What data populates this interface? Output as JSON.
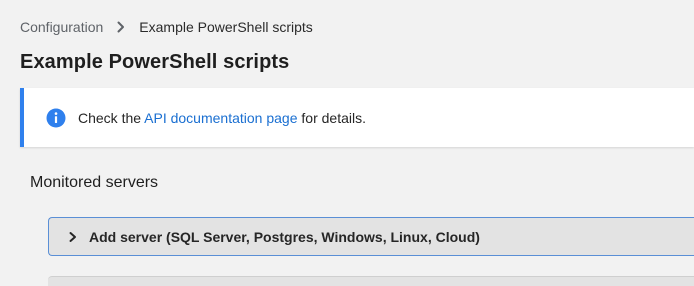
{
  "breadcrumb": {
    "root": "Configuration",
    "current": "Example PowerShell scripts"
  },
  "page_title": "Example PowerShell scripts",
  "info_banner": {
    "prefix": "Check the ",
    "link": "API documentation page",
    "suffix": " for details.",
    "accent_color": "#2f80ed"
  },
  "section_title": "Monitored servers",
  "add_server": {
    "label": "Add server (SQL Server, Postgres, Windows, Linux, Cloud)",
    "expanded": false
  },
  "icons": {
    "breadcrumb_separator": "chevron-right-icon",
    "banner": "info-icon",
    "expander": "chevron-right-icon"
  }
}
